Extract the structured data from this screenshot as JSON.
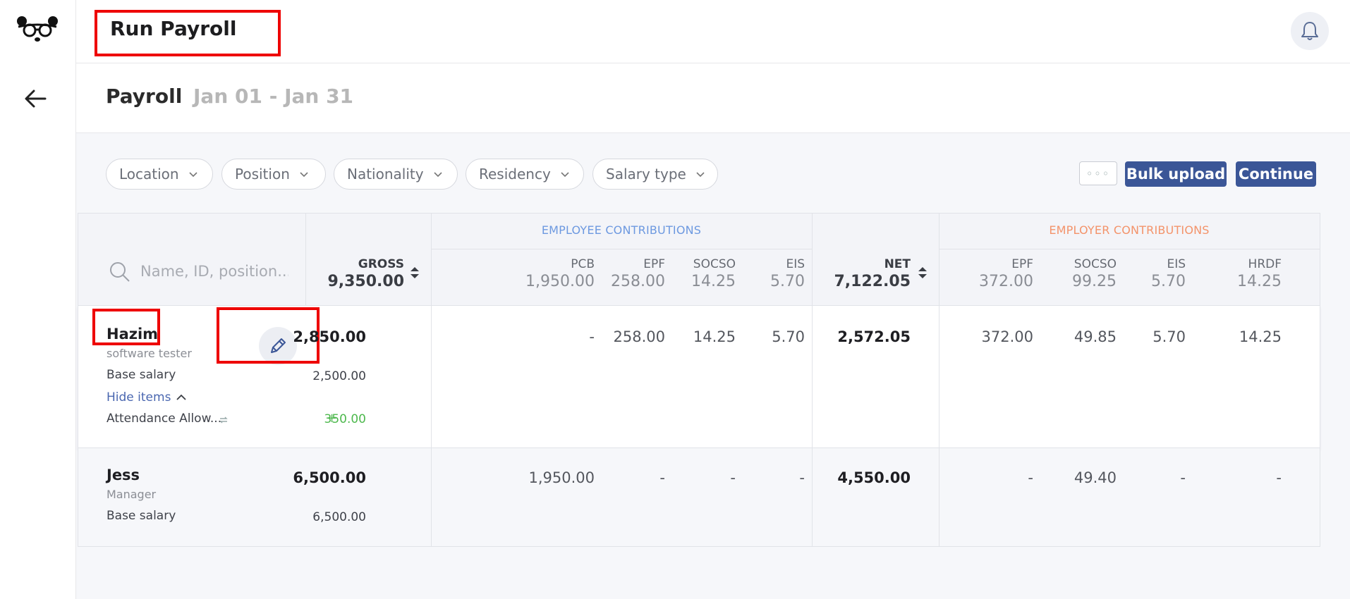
{
  "app": {
    "title": "Run Payroll"
  },
  "subheader": {
    "title": "Payroll",
    "range": "Jan 01 - Jan 31"
  },
  "filters": [
    "Location",
    "Position",
    "Nationality",
    "Residency",
    "Salary type"
  ],
  "actions": {
    "more": "◦◦◦",
    "bulk_upload": "Bulk upload",
    "continue": "Continue"
  },
  "search": {
    "placeholder": "Name, ID, position..."
  },
  "groups": {
    "employee": "EMPLOYEE CONTRIBUTIONS",
    "employer": "EMPLOYER CONTRIBUTIONS"
  },
  "colors": {
    "employee_group": "#6d99e0",
    "employer_group": "#f3936a",
    "primary": "#3b5697",
    "highlight": "#e00000"
  },
  "columns": {
    "gross": {
      "label": "GROSS",
      "total": "9,350.00"
    },
    "pcb": {
      "label": "PCB",
      "total": "1,950.00"
    },
    "epf": {
      "label": "EPF",
      "total": "258.00"
    },
    "socso": {
      "label": "SOCSO",
      "total": "14.25"
    },
    "eis": {
      "label": "EIS",
      "total": "5.70"
    },
    "net": {
      "label": "NET",
      "total": "7,122.05"
    },
    "er_epf": {
      "label": "EPF",
      "total": "372.00"
    },
    "er_socso": {
      "label": "SOCSO",
      "total": "99.25"
    },
    "er_eis": {
      "label": "EIS",
      "total": "5.70"
    },
    "hrdf": {
      "label": "HRDF",
      "total": "14.25"
    }
  },
  "rows": [
    {
      "name": "Hazim",
      "position": "software tester",
      "base_label": "Base salary",
      "base_value": "2,500.00",
      "toggle_label": "Hide items",
      "allowance_label": "Attendance Allow...",
      "allowance_value": "350.00",
      "gross": "2,850.00",
      "pcb": "-",
      "epf": "258.00",
      "socso": "14.25",
      "eis": "5.70",
      "net": "2,572.05",
      "er_epf": "372.00",
      "er_socso": "49.85",
      "er_eis": "5.70",
      "hrdf": "14.25"
    },
    {
      "name": "Jess",
      "position": "Manager",
      "base_label": "Base salary",
      "base_value": "6,500.00",
      "gross": "6,500.00",
      "pcb": "1,950.00",
      "epf": "-",
      "socso": "-",
      "eis": "-",
      "net": "4,550.00",
      "er_epf": "-",
      "er_socso": "49.40",
      "er_eis": "-",
      "hrdf": "-"
    }
  ]
}
